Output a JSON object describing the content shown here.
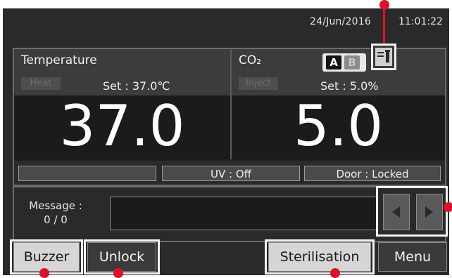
{
  "header": {
    "date": "24/Jun/2016",
    "time": "11:01:22"
  },
  "temperature": {
    "title": "Temperature",
    "mode_label": "Heat",
    "set_text": "Set : 37.0℃",
    "value": "37.0"
  },
  "co2": {
    "title": "CO₂",
    "mode_label": "Inject",
    "set_text": "Set :  5.0%",
    "value": "5.0",
    "cylinder_a": "A",
    "cylinder_b": "B"
  },
  "status": {
    "left": "",
    "uv": "UV : Off",
    "door": "Door : Locked"
  },
  "message": {
    "label": "Message :",
    "count": "0 / 0",
    "text": ""
  },
  "buttons": {
    "buzzer": "Buzzer",
    "unlock": "Unlock",
    "sterilisation": "Sterilisation",
    "menu": "Menu"
  },
  "colors": {
    "callout": "#e0102a",
    "screen": "#2a2a2a"
  }
}
